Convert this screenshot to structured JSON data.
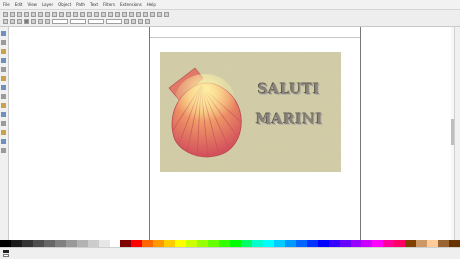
{
  "menu": {
    "items": [
      "File",
      "Edit",
      "View",
      "Layer",
      "Object",
      "Path",
      "Text",
      "Filters",
      "Extensions",
      "Help"
    ]
  },
  "canvas": {
    "title_line1": "SALUTI",
    "title_line2": "MARINI"
  },
  "colors": {
    "sand": "#d3cda4",
    "shell_dark": "#d8525d",
    "shell_light": "#f6b777",
    "text": "#8a847b"
  },
  "palette": [
    "#000000",
    "#1a1a1a",
    "#333333",
    "#4d4d4d",
    "#666666",
    "#808080",
    "#999999",
    "#b3b3b3",
    "#cccccc",
    "#e6e6e6",
    "#ffffff",
    "#800000",
    "#ff0000",
    "#ff6600",
    "#ff9900",
    "#ffcc00",
    "#ffff00",
    "#ccff00",
    "#99ff00",
    "#66ff00",
    "#33ff00",
    "#00ff00",
    "#00ff66",
    "#00ffcc",
    "#00ffff",
    "#00ccff",
    "#0099ff",
    "#0066ff",
    "#0033ff",
    "#0000ff",
    "#3300ff",
    "#6600ff",
    "#9900ff",
    "#cc00ff",
    "#ff00ff",
    "#ff0099",
    "#ff0066",
    "#804000",
    "#cc9966",
    "#ffcc99",
    "#996633",
    "#663300"
  ],
  "icons": [
    "select-tool-icon",
    "node-tool-icon",
    "zoom-tool-icon",
    "rectangle-tool-icon",
    "ellipse-tool-icon",
    "star-tool-icon",
    "spiral-tool-icon",
    "pencil-tool-icon",
    "pen-tool-icon",
    "calligraphy-tool-icon",
    "text-tool-icon",
    "gradient-tool-icon",
    "dropper-tool-icon",
    "bucket-tool-icon"
  ]
}
